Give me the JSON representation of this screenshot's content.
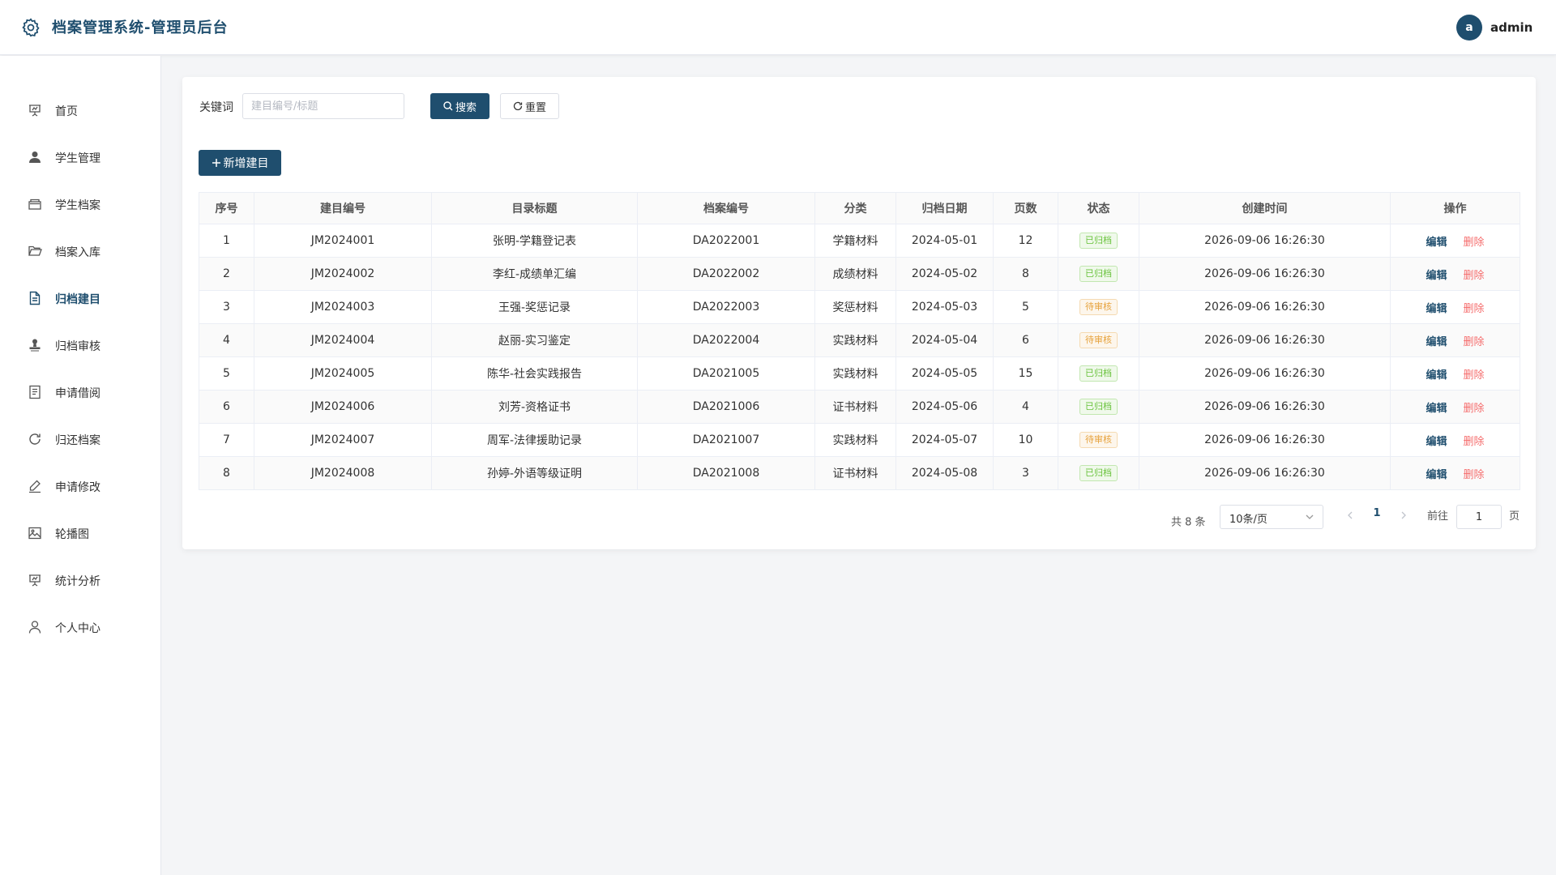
{
  "header": {
    "title": "档案管理系统-管理员后台",
    "avatar_letter": "a",
    "username": "admin"
  },
  "sidebar": {
    "items": [
      {
        "label": "首页",
        "icon": "presentation-icon"
      },
      {
        "label": "学生管理",
        "icon": "user-icon"
      },
      {
        "label": "学生档案",
        "icon": "archive-box-icon"
      },
      {
        "label": "档案入库",
        "icon": "folder-open-icon"
      },
      {
        "label": "归档建目",
        "icon": "document-icon",
        "active": true
      },
      {
        "label": "归档审核",
        "icon": "stamp-icon"
      },
      {
        "label": "申请借阅",
        "icon": "list-document-icon"
      },
      {
        "label": "归还档案",
        "icon": "refresh-icon"
      },
      {
        "label": "申请修改",
        "icon": "edit-pen-icon"
      },
      {
        "label": "轮播图",
        "icon": "picture-icon"
      },
      {
        "label": "统计分析",
        "icon": "chart-board-icon"
      },
      {
        "label": "个人中心",
        "icon": "user-outline-icon"
      }
    ]
  },
  "search": {
    "label": "关键词",
    "value": "",
    "placeholder": "建目编号/标题",
    "search_label": "搜索",
    "reset_label": "重置"
  },
  "toolbar": {
    "add_label": "新增建目"
  },
  "table": {
    "columns": [
      "序号",
      "建目编号",
      "目录标题",
      "档案编号",
      "分类",
      "归档日期",
      "页数",
      "状态",
      "创建时间",
      "操作"
    ],
    "rows": [
      [
        "1",
        "JM2024001",
        "张明-学籍登记表",
        "DA2022001",
        "学籍材料",
        "2024-05-01",
        "12",
        "已归档",
        "2026-09-06 16:26:30"
      ],
      [
        "2",
        "JM2024002",
        "李红-成绩单汇编",
        "DA2022002",
        "成绩材料",
        "2024-05-02",
        "8",
        "已归档",
        "2026-09-06 16:26:30"
      ],
      [
        "3",
        "JM2024003",
        "王强-奖惩记录",
        "DA2022003",
        "奖惩材料",
        "2024-05-03",
        "5",
        "待审核",
        "2026-09-06 16:26:30"
      ],
      [
        "4",
        "JM2024004",
        "赵丽-实习鉴定",
        "DA2022004",
        "实践材料",
        "2024-05-04",
        "6",
        "待审核",
        "2026-09-06 16:26:30"
      ],
      [
        "5",
        "JM2024005",
        "陈华-社会实践报告",
        "DA2021005",
        "实践材料",
        "2024-05-05",
        "15",
        "已归档",
        "2026-09-06 16:26:30"
      ],
      [
        "6",
        "JM2024006",
        "刘芳-资格证书",
        "DA2021006",
        "证书材料",
        "2024-05-06",
        "4",
        "已归档",
        "2026-09-06 16:26:30"
      ],
      [
        "7",
        "JM2024007",
        "周军-法律援助记录",
        "DA2021007",
        "实践材料",
        "2024-05-07",
        "10",
        "待审核",
        "2026-09-06 16:26:30"
      ],
      [
        "8",
        "JM2024008",
        "孙婷-外语等级证明",
        "DA2021008",
        "证书材料",
        "2024-05-08",
        "3",
        "已归档",
        "2026-09-06 16:26:30"
      ]
    ],
    "edit_label": "编辑",
    "delete_label": "删除",
    "status_archived": "已归档"
  },
  "pagination": {
    "total": "共 8 条",
    "page_size": "10条/页",
    "current_page": "1",
    "goto_label": "前往",
    "goto_value": "1",
    "page_unit": "页"
  },
  "colors": {
    "primary": "#1f4e6e",
    "danger": "#f56c6c",
    "success": "#67c23a",
    "warning": "#e6a23c"
  }
}
